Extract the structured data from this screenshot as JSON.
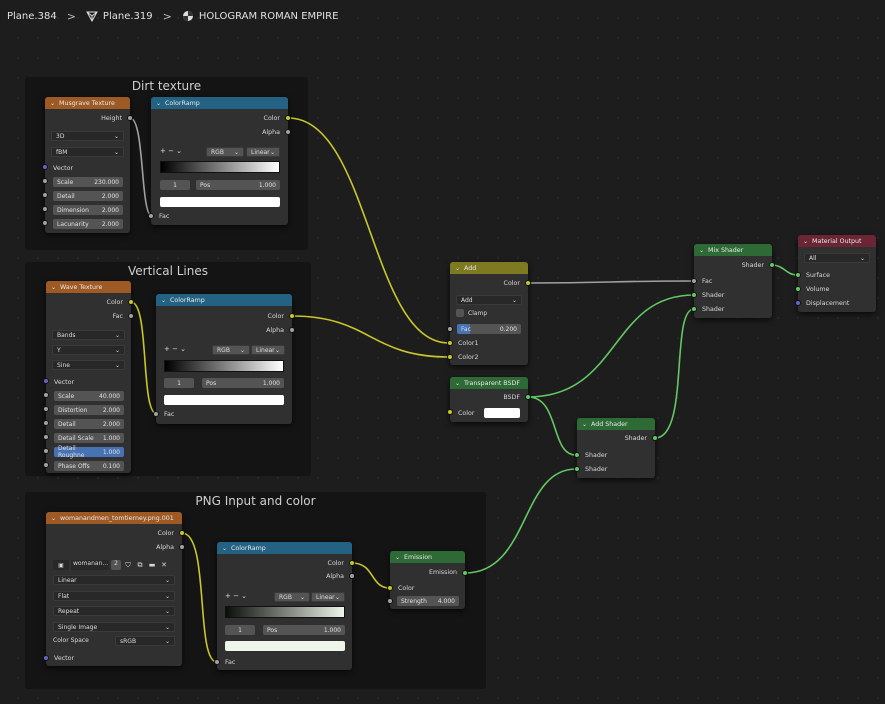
{
  "breadcrumb": {
    "object": "Plane.384",
    "mesh": "Plane.319",
    "material": "HOLOGRAM ROMAN EMPIRE"
  },
  "frames": {
    "dirt": "Dirt texture",
    "vertical": "Vertical Lines",
    "png": "PNG Input and color"
  },
  "musgrave": {
    "title": "Musgrave Texture",
    "out": "Height",
    "dim": "3D",
    "type": "fBM",
    "vector": "Vector",
    "scale_l": "Scale",
    "scale_v": "230.000",
    "detail_l": "Detail",
    "detail_v": "2.000",
    "dimension_l": "Dimension",
    "dimension_v": "2.000",
    "lac_l": "Lacunarity",
    "lac_v": "2.000"
  },
  "ramp1": {
    "title": "ColorRamp",
    "color": "Color",
    "alpha": "Alpha",
    "mode": "RGB",
    "interp": "Linear",
    "idx": "1",
    "pos_l": "Pos",
    "pos_v": "1.000",
    "fac": "Fac",
    "tools": "+ − ⌄"
  },
  "wave": {
    "title": "Wave Texture",
    "color": "Color",
    "fac": "Fac",
    "type": "Bands",
    "dir": "Y",
    "profile": "Sine",
    "vector": "Vector",
    "scale_l": "Scale",
    "scale_v": "40.000",
    "dist_l": "Distortion",
    "dist_v": "2.000",
    "detail_l": "Detail",
    "detail_v": "2.000",
    "dscale_l": "Detail Scale",
    "dscale_v": "1.000",
    "drough_l": "Detail Roughne",
    "drough_v": "1.000",
    "phase_l": "Phase Offs",
    "phase_v": "0.100"
  },
  "ramp2": {
    "title": "ColorRamp",
    "color": "Color",
    "alpha": "Alpha",
    "mode": "RGB",
    "interp": "Linear",
    "idx": "1",
    "pos_l": "Pos",
    "pos_v": "1.000",
    "fac": "Fac",
    "tools": "+ − ⌄"
  },
  "image": {
    "title": "womanandmen_tomtierney.png.001",
    "color": "Color",
    "alpha": "Alpha",
    "name": "womanan...",
    "users": "2",
    "interp": "Linear",
    "proj": "Flat",
    "ext": "Repeat",
    "source": "Single Image",
    "cs_l": "Color Space",
    "cs_v": "sRGB",
    "vector": "Vector"
  },
  "ramp3": {
    "title": "ColorRamp",
    "color": "Color",
    "alpha": "Alpha",
    "mode": "RGB",
    "interp": "Linear",
    "idx": "1",
    "pos_l": "Pos",
    "pos_v": "1.000",
    "fac": "Fac",
    "tools": "+ − ⌄"
  },
  "add": {
    "title": "Add",
    "color": "Color",
    "op": "Add",
    "clamp": "Clamp",
    "fac_l": "Fac",
    "fac_v": "0.200",
    "c1": "Color1",
    "c2": "Color2"
  },
  "transp": {
    "title": "Transparent BSDF",
    "bsdf": "BSDF",
    "color": "Color"
  },
  "emission": {
    "title": "Emission",
    "out": "Emission",
    "color": "Color",
    "str_l": "Strength",
    "str_v": "4.000"
  },
  "addshader": {
    "title": "Add Shader",
    "out": "Shader",
    "s1": "Shader",
    "s2": "Shader"
  },
  "mix": {
    "title": "Mix Shader",
    "out": "Shader",
    "fac": "Fac",
    "s1": "Shader",
    "s2": "Shader"
  },
  "output": {
    "title": "Material Output",
    "target": "All",
    "surface": "Surface",
    "volume": "Volume",
    "disp": "Displacement"
  }
}
